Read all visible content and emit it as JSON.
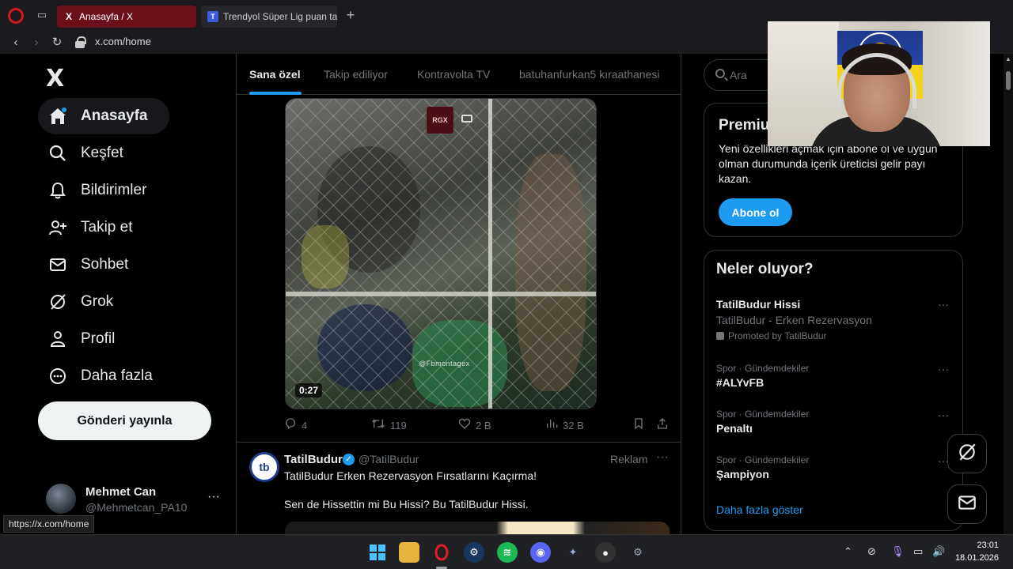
{
  "browser": {
    "tabs": [
      {
        "title": "Anasayfa / X",
        "favicon": "X"
      },
      {
        "title": "Trendyol Süper Lig puan ta",
        "favicon": "T"
      }
    ],
    "url": "x.com/home",
    "status_url": "https://x.com/home"
  },
  "sidebar": {
    "logo": "X",
    "items": [
      {
        "label": "Anasayfa",
        "icon": "home-icon"
      },
      {
        "label": "Keşfet",
        "icon": "search-icon"
      },
      {
        "label": "Bildirimler",
        "icon": "bell-icon"
      },
      {
        "label": "Takip et",
        "icon": "follow-icon"
      },
      {
        "label": "Sohbet",
        "icon": "mail-icon"
      },
      {
        "label": "Grok",
        "icon": "grok-icon"
      },
      {
        "label": "Profil",
        "icon": "person-icon"
      },
      {
        "label": "Daha fazla",
        "icon": "more-icon"
      }
    ],
    "post_button": "Gönderi yayınla",
    "profile": {
      "name": "Mehmet Can",
      "handle": "@Mehmetcan_PA10",
      "more": "···"
    }
  },
  "feed": {
    "tabs": [
      "Sana özel",
      "Takip ediliyor",
      "Kontravolta TV",
      "batuhanfurkan5 kıraathanesi"
    ],
    "video": {
      "badge": "RGX",
      "watermark": "@Fbmontagex",
      "duration": "0:27"
    },
    "actions": {
      "replies": "4",
      "reposts": "119",
      "likes": "2 B",
      "views": "32 B"
    },
    "ad": {
      "logo": "tb",
      "name": "TatilBudur",
      "handle": "@TatilBudur",
      "label": "Reklam",
      "more": "···",
      "text1": "TatilBudur Erken Rezervasyon Fırsatlarını Kaçırma!",
      "text2": "Sen de Hissettin mi Bu Hissi? Bu TatilBudur Hissi."
    }
  },
  "right": {
    "search_placeholder": "Ara",
    "premium": {
      "title": "Premiu",
      "desc": "Yeni özellikleri açmak için abone ol ve uygun olman durumunda içerik üreticisi gelir payı kazan.",
      "button": "Abone ol"
    },
    "trends": {
      "title": "Neler oluyor?",
      "items": [
        {
          "meta": "",
          "name": "TatilBudur Hissi",
          "sub": "TatilBudur - Erken Rezervasyon",
          "promo": "Promoted by TatilBudur"
        },
        {
          "meta": "Spor · Gündemdekiler",
          "name": "#ALYvFB"
        },
        {
          "meta": "Spor · Gündemdekiler",
          "name": "Penaltı"
        },
        {
          "meta": "Spor · Gündemdekiler",
          "name": "Şampiyon"
        }
      ],
      "show_more": "Daha fazla göster",
      "dots": "···"
    }
  },
  "taskbar": {
    "time": "23:01",
    "date": "18.01.2026"
  },
  "colors": {
    "accent": "#1d9bf0",
    "opera_red": "#d4141f",
    "tab_active": "#6b0f1a"
  }
}
